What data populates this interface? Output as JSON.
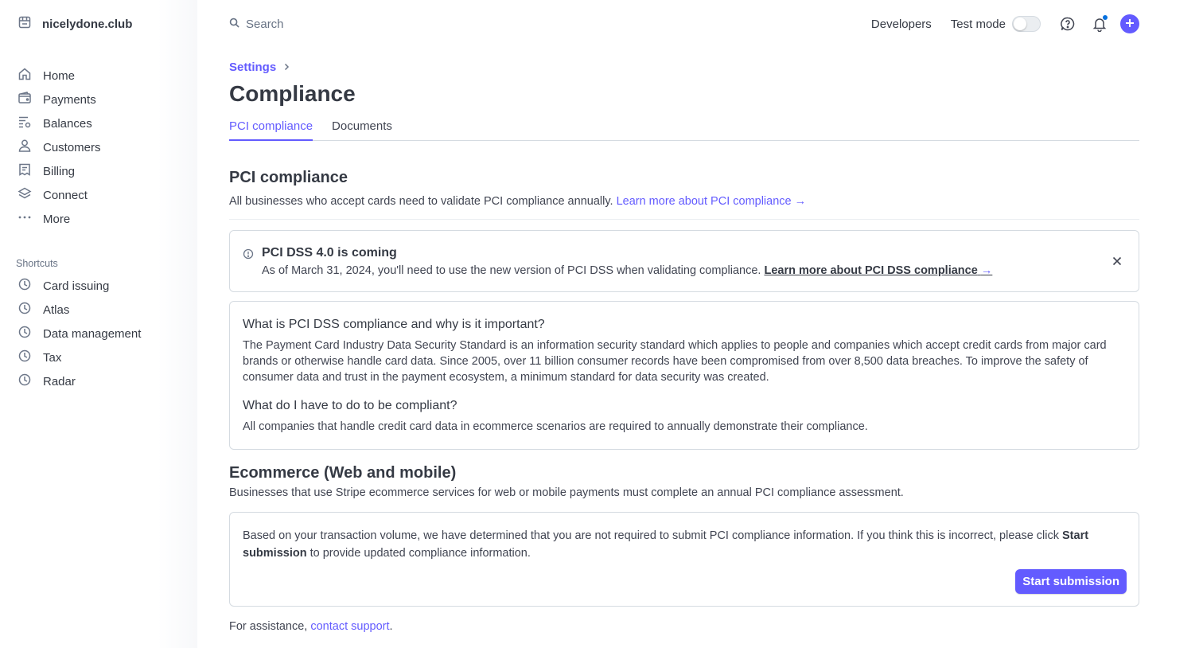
{
  "account": {
    "name": "nicelydone.club"
  },
  "sidebar": {
    "items": [
      {
        "label": "Home",
        "icon": "home-icon"
      },
      {
        "label": "Payments",
        "icon": "wallet-icon"
      },
      {
        "label": "Balances",
        "icon": "balances-icon"
      },
      {
        "label": "Customers",
        "icon": "person-icon"
      },
      {
        "label": "Billing",
        "icon": "receipt-icon"
      },
      {
        "label": "Connect",
        "icon": "layers-icon"
      },
      {
        "label": "More",
        "icon": "more-dots-icon"
      }
    ],
    "shortcuts_label": "Shortcuts",
    "shortcuts": [
      {
        "label": "Card issuing",
        "icon": "clock-icon"
      },
      {
        "label": "Atlas",
        "icon": "clock-icon"
      },
      {
        "label": "Data management",
        "icon": "clock-icon"
      },
      {
        "label": "Tax",
        "icon": "clock-icon"
      },
      {
        "label": "Radar",
        "icon": "clock-icon"
      }
    ]
  },
  "topbar": {
    "search_placeholder": "Search",
    "developers": "Developers",
    "test_mode": "Test mode",
    "test_mode_on": false
  },
  "page": {
    "breadcrumb": "Settings",
    "title": "Compliance",
    "tabs": [
      {
        "label": "PCI compliance",
        "active": true
      },
      {
        "label": "Documents",
        "active": false
      }
    ]
  },
  "pci": {
    "title": "PCI compliance",
    "desc": "All businesses who accept cards need to validate PCI compliance annually.",
    "link": "Learn more about PCI compliance",
    "link_arrow": "→"
  },
  "banner": {
    "title": "PCI DSS 4.0 is coming",
    "text": "As of March 31, 2024, you'll need to use the new version of PCI DSS when validating compliance.",
    "link": "Learn more about PCI DSS compliance",
    "link_arrow": "→"
  },
  "info": {
    "q1": "What is PCI DSS compliance and why is it important?",
    "a1": "The Payment Card Industry Data Security Standard is an information security standard which applies to people and companies which accept credit cards from major card brands or otherwise handle card data. Since 2005, over 11 billion consumer records have been compromised from over 8,500 data breaches. To improve the safety of consumer data and trust in the payment ecosystem, a minimum standard for data security was created.",
    "q2": "What do I have to do to be compliant?",
    "a2": "All companies that handle credit card data in ecommerce scenarios are required to annually demonstrate their compliance."
  },
  "ecommerce": {
    "title": "Ecommerce (Web and mobile)",
    "desc": "Businesses that use Stripe ecommerce services for web or mobile payments must complete an annual PCI compliance assessment.",
    "card_text_1": "Based on your transaction volume, we have determined that you are not required to submit PCI compliance information. If you think this is incorrect, please click",
    "card_bold": "Start submission",
    "card_text_2": "to provide updated compliance information.",
    "button": "Start submission"
  },
  "assist": {
    "prefix": "For assistance,",
    "link": "contact support",
    "suffix": "."
  },
  "colors": {
    "accent": "#635bff",
    "text": "#414552",
    "border": "#d5dbe1",
    "notification_dot": "#0570de"
  }
}
